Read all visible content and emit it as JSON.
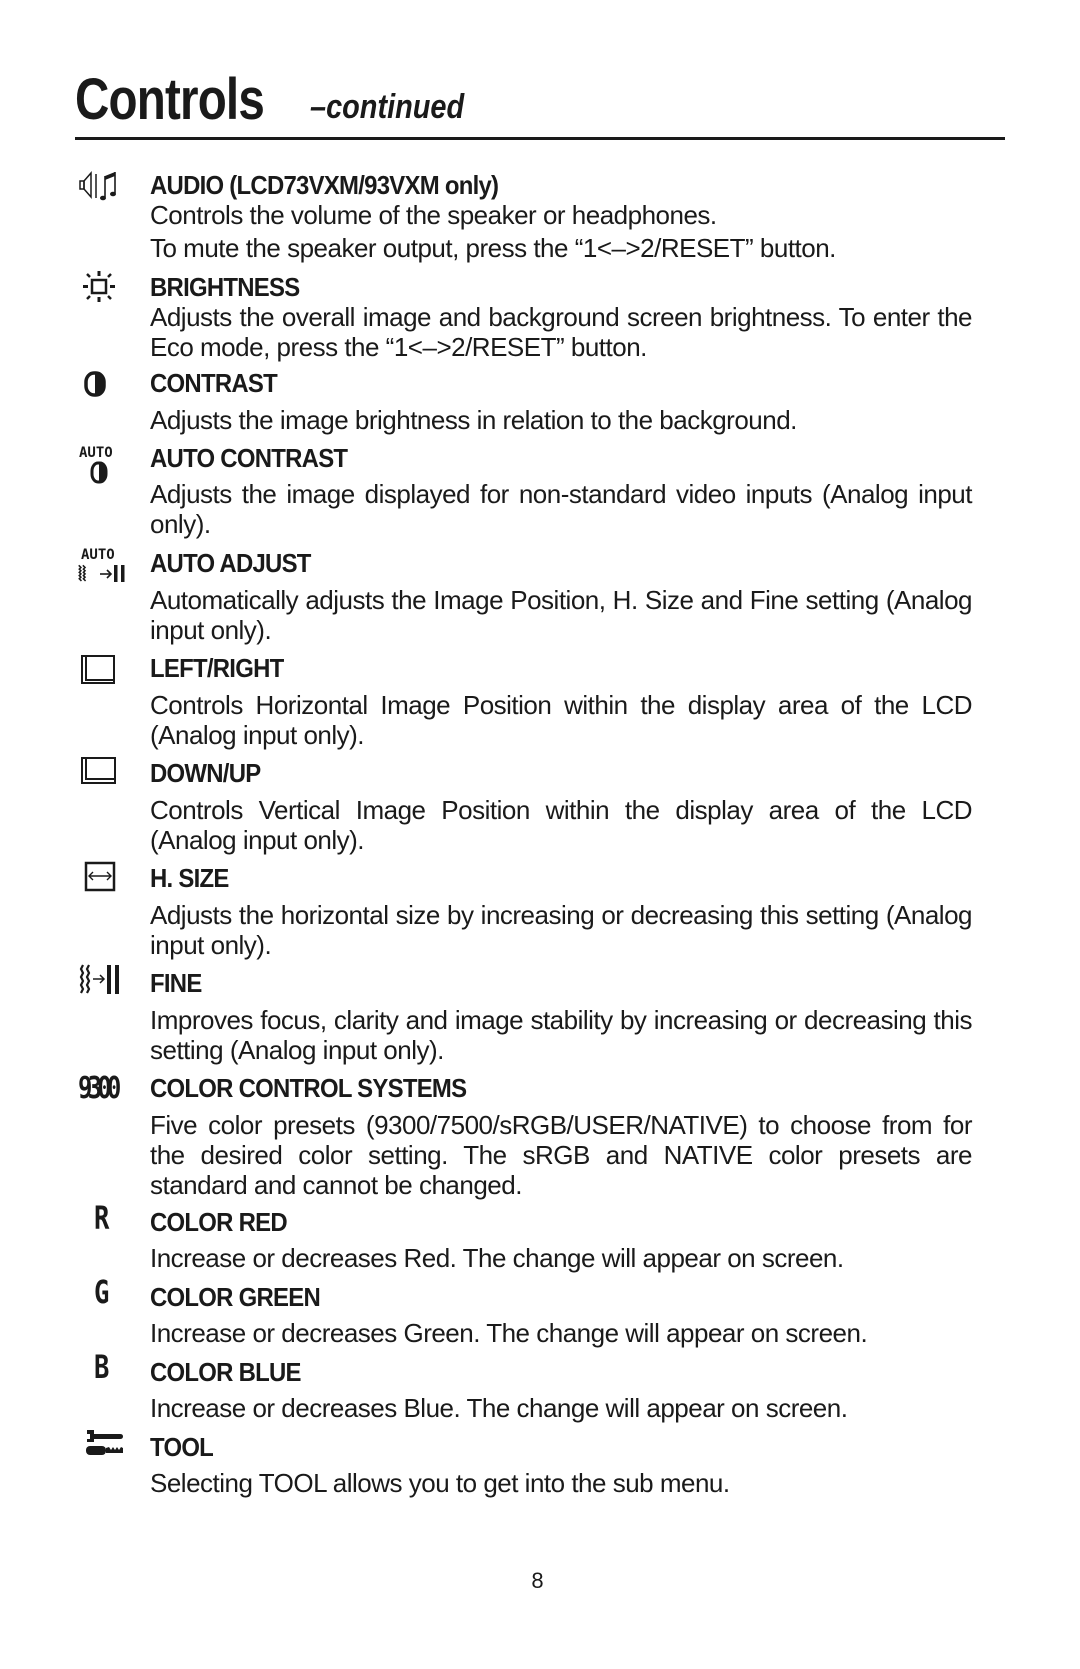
{
  "page": {
    "title": "Controls",
    "subtitle": "–continued",
    "page_number": "8"
  },
  "entries": [
    {
      "icon": "audio-icon",
      "heading": "AUDIO (LCD73VXM/93VXM only)",
      "description": [
        "Controls the volume of the speaker or headphones.",
        "To mute the speaker output, press the “1<–>2/RESET” button."
      ]
    },
    {
      "icon": "brightness-icon",
      "heading": "BRIGHTNESS",
      "description": [
        "Adjusts the overall image and background screen brightness. To enter the Eco mode, press the “1<–>2/RESET” button."
      ]
    },
    {
      "icon": "contrast-icon",
      "heading": "CONTRAST",
      "description": [
        "Adjusts the image brightness in relation to the background."
      ]
    },
    {
      "icon": "auto-contrast-icon",
      "icon_text": "AUTO",
      "heading": "AUTO CONTRAST",
      "description": [
        "Adjusts the image displayed for non-standard video inputs (Analog input only)."
      ]
    },
    {
      "icon": "auto-adjust-icon",
      "icon_text": "AUTO",
      "heading": "AUTO ADJUST",
      "description": [
        "Automatically adjusts the Image Position, H. Size and Fine setting (Analog input only)."
      ]
    },
    {
      "icon": "left-right-icon",
      "heading": "LEFT/RIGHT",
      "description": [
        "Controls Horizontal Image Position within the display area of the LCD (Analog input only)."
      ]
    },
    {
      "icon": "down-up-icon",
      "heading": "DOWN/UP",
      "description": [
        "Controls Vertical Image Position within the display area of the LCD (Analog input only)."
      ]
    },
    {
      "icon": "h-size-icon",
      "heading": "H. SIZE",
      "description": [
        "Adjusts the horizontal size by increasing or decreasing this setting (Analog input only)."
      ]
    },
    {
      "icon": "fine-icon",
      "heading": "FINE",
      "description": [
        "Improves focus, clarity and image stability by increasing or decreasing this setting (Analog input only)."
      ]
    },
    {
      "icon": "color-control-icon",
      "icon_text": "9300",
      "heading": "COLOR CONTROL SYSTEMS",
      "description": [
        "Five color presets (9300/7500/sRGB/USER/NATIVE) to choose from for the desired color setting. The sRGB and NATIVE color presets are standard and cannot be changed."
      ]
    },
    {
      "icon": "color-red-icon",
      "icon_text": "R",
      "heading": "COLOR RED",
      "description": [
        "Increase or decreases Red. The change will appear on screen."
      ]
    },
    {
      "icon": "color-green-icon",
      "icon_text": "G",
      "heading": "COLOR GREEN",
      "description": [
        "Increase or decreases Green. The change will appear on screen."
      ]
    },
    {
      "icon": "color-blue-icon",
      "icon_text": "B",
      "heading": "COLOR BLUE",
      "description": [
        "Increase or decreases Blue. The change will appear on screen."
      ]
    },
    {
      "icon": "tool-icon",
      "heading": "TOOL",
      "description": [
        "Selecting TOOL allows you to get into the sub menu."
      ]
    }
  ]
}
